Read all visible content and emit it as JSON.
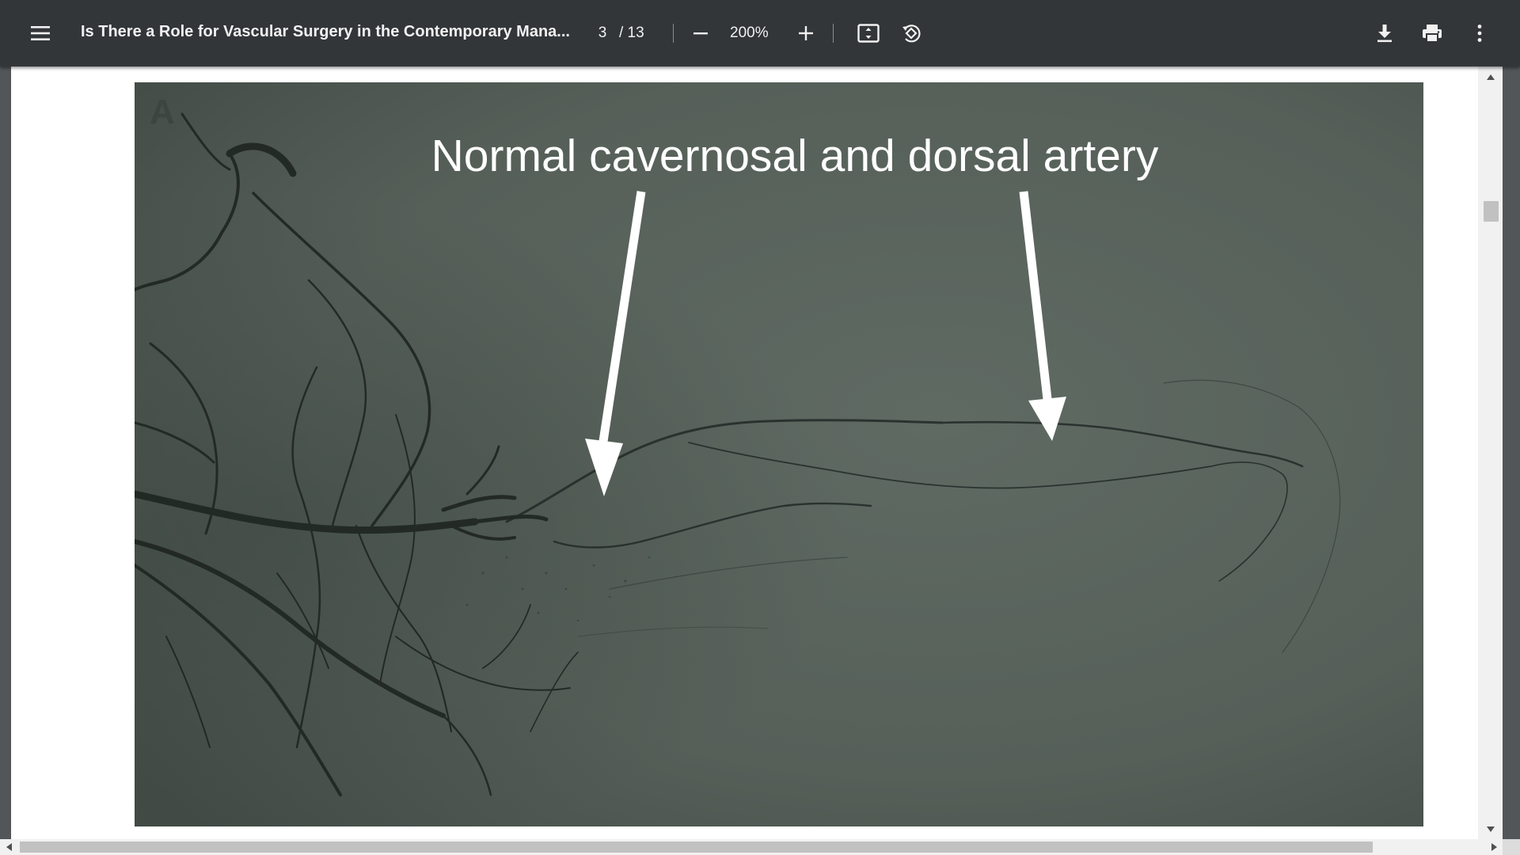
{
  "toolbar": {
    "title": "Is There a Role for Vascular Surgery in the Contemporary Mana...",
    "current_page": "3",
    "total_pages": "/ 13",
    "zoom": "200%",
    "icons": {
      "menu": "menu-icon",
      "zoom_out": "minus-icon",
      "zoom_in": "plus-icon",
      "fit": "fit-to-page-icon",
      "rotate": "rotate-icon",
      "download": "download-icon",
      "print": "print-icon",
      "more": "more-vertical-icon"
    }
  },
  "figure": {
    "panel_letter": "A",
    "caption": "Normal cavernosal and dorsal artery",
    "colors": {
      "background": "#566059",
      "vessels": "#1d2320",
      "arrows": "#ffffff"
    }
  },
  "colors": {
    "toolbar": "#323639",
    "viewer_background": "#525659",
    "page": "#ffffff",
    "scrollbar_track": "#f1f1f1",
    "scrollbar_thumb": "#c1c1c1"
  }
}
